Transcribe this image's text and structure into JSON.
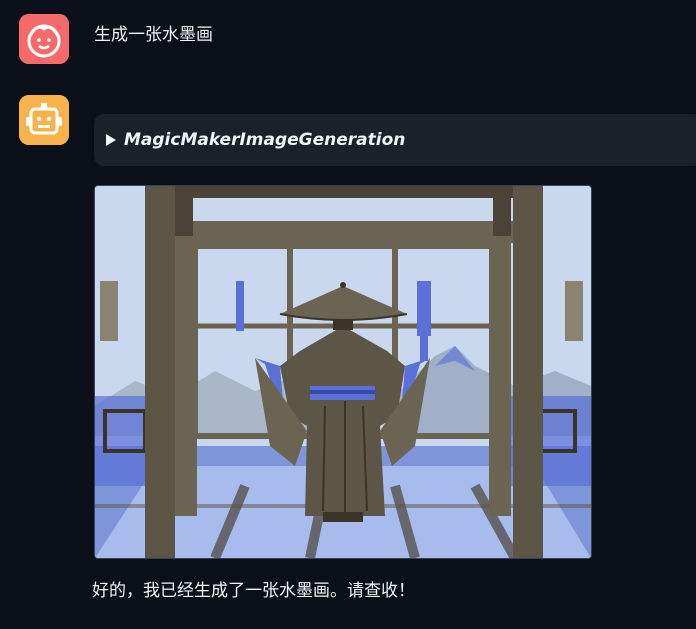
{
  "conversation": {
    "user_message": "生成一张水墨画",
    "tool_call_name": "MagicMakerImageGeneration",
    "bot_reply": "好的，我已经生成了一张水墨画。请查收！"
  },
  "avatars": {
    "user": {
      "icon": "smiling-face-icon",
      "color": "#f56b6b"
    },
    "bot": {
      "icon": "robot-icon",
      "color": "#f7b34b"
    }
  },
  "image": {
    "subject": "figure-in-robe-and-conical-hat",
    "palette": [
      "#c8d6ee",
      "#5c5647",
      "#5a6fd8",
      "#3a3428"
    ]
  }
}
